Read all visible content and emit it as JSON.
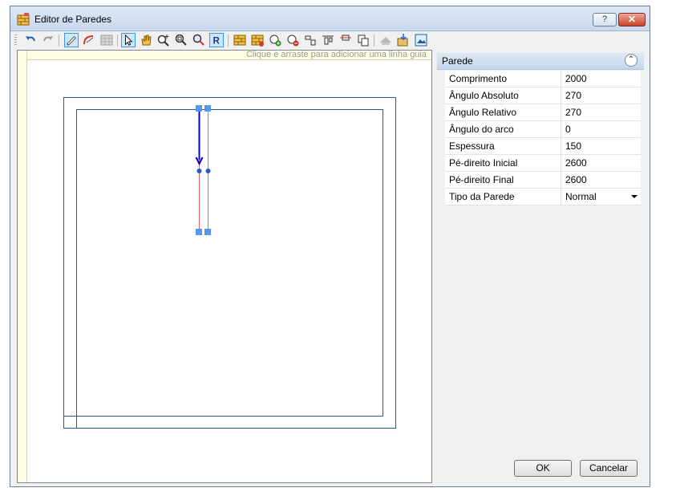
{
  "window": {
    "title": "Editor de Paredes",
    "help_label": "?",
    "close_label": "✕"
  },
  "toolbar": {
    "buttons": [
      "undo-icon",
      "redo-icon",
      "draw-wall-icon",
      "draw-arc-wall-icon",
      "grid-icon",
      "select-pointer-icon",
      "pan-hand-icon",
      "zoom-in-icon",
      "zoom-window-icon",
      "zoom-extents-icon",
      "refresh-icon",
      "wall-brick-icon",
      "wall-brick-edit-icon",
      "add-node-icon",
      "remove-node-icon",
      "align-left-icon",
      "align-top-icon",
      "align-center-icon",
      "copy-icon",
      "roof-icon",
      "import-icon",
      "image-icon"
    ]
  },
  "canvas": {
    "hint": "Clique e arraste para adicionar uma linha guia"
  },
  "properties": {
    "title": "Parede",
    "rows": [
      {
        "label": "Comprimento",
        "value": "2000"
      },
      {
        "label": "Ângulo Absoluto",
        "value": "270"
      },
      {
        "label": "Ângulo Relativo",
        "value": "270"
      },
      {
        "label": "Ângulo do arco",
        "value": "0"
      },
      {
        "label": "Espessura",
        "value": "150"
      },
      {
        "label": "Pé-direito Inicial",
        "value": "2600"
      },
      {
        "label": "Pé-direito Final",
        "value": "2600"
      },
      {
        "label": "Tipo da Parede",
        "value": "Normal"
      }
    ]
  },
  "buttons": {
    "ok": "OK",
    "cancel": "Cancelar"
  },
  "colors": {
    "accent": "#3399ff",
    "wall_outline": "#1f5f99",
    "wall_selected": "#e06060",
    "direction_arrow": "#0000cc"
  }
}
